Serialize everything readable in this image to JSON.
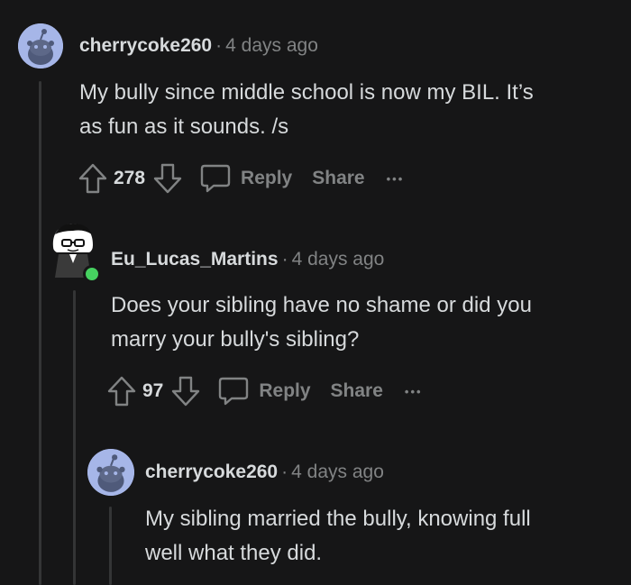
{
  "comments": [
    {
      "username": "cherrycoke260",
      "separator": "·",
      "time": "4 days ago",
      "body_lines": [
        "My bully since middle school is now my BIL. It’s",
        "as fun as it sounds. /s"
      ],
      "votes": "278",
      "reply_label": "Reply",
      "share_label": "Share",
      "more_label": "•••"
    },
    {
      "username": "Eu_Lucas_Martins",
      "separator": "·",
      "time": "4 days ago",
      "body_lines": [
        "Does your sibling have no shame or did you",
        "marry your bully's sibling?"
      ],
      "votes": "97",
      "reply_label": "Reply",
      "share_label": "Share",
      "more_label": "•••"
    },
    {
      "username": "cherrycoke260",
      "separator": "·",
      "time": "4 days ago",
      "body_lines": [
        "My sibling married the bully, knowing full",
        "well what they did."
      ]
    }
  ],
  "colors": {
    "background": "#161617",
    "text": "#d7dadc",
    "muted": "#818384",
    "thread_line": "#343536",
    "snoo_avatar_bg": "#a6b6e8",
    "online": "#46d160"
  },
  "icons": [
    "snoo-avatar-icon",
    "upvote-icon",
    "downvote-icon",
    "comment-icon",
    "more-icon"
  ]
}
